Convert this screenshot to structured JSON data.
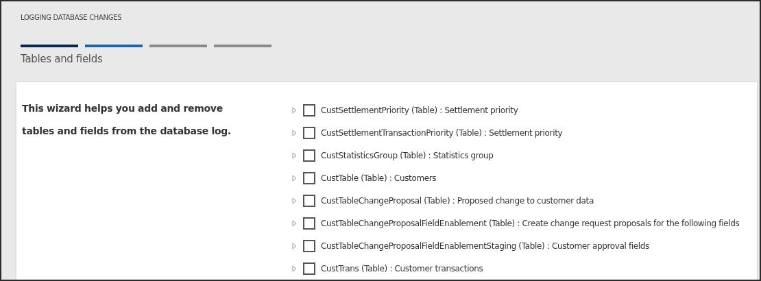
{
  "window": {
    "title": "LOGGING DATABASE CHANGES"
  },
  "steps": [
    {
      "completed": true,
      "selected": false
    },
    {
      "completed": false,
      "selected": true
    },
    {
      "completed": false,
      "selected": false
    },
    {
      "completed": false,
      "selected": false
    }
  ],
  "page_title": "Tables and fields",
  "description": "This wizard helps you add and remove tables and fields from the database log.",
  "tree": [
    {
      "label": "CustSettlementPriority (Table) : Settlement priority",
      "checked": false,
      "expanded": false
    },
    {
      "label": "CustSettlementTransactionPriority (Table) : Settlement priority",
      "checked": false,
      "expanded": false
    },
    {
      "label": "CustStatisticsGroup (Table) : Statistics group",
      "checked": false,
      "expanded": false
    },
    {
      "label": "CustTable (Table) : Customers",
      "checked": false,
      "expanded": false
    },
    {
      "label": "CustTableChangeProposal (Table) : Proposed change to customer data",
      "checked": false,
      "expanded": false
    },
    {
      "label": "CustTableChangeProposalFieldEnablement (Table) : Create change request proposals for the following fields",
      "checked": false,
      "expanded": false
    },
    {
      "label": "CustTableChangeProposalFieldEnablementStaging (Table) : Customer approval fields",
      "checked": false,
      "expanded": false
    },
    {
      "label": "CustTrans (Table) : Customer transactions",
      "checked": false,
      "expanded": false
    }
  ]
}
